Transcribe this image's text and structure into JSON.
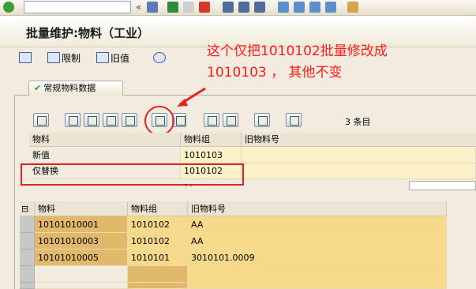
{
  "toolbar": {
    "icons": [
      "enter-icon",
      "save-icon",
      "back-icon",
      "exit-icon",
      "cancel-icon",
      "print-icon",
      "find-icon",
      "find-next-icon",
      "first-page-icon",
      "prev-page-icon",
      "next-page-icon",
      "last-page-icon",
      "new-session-icon"
    ],
    "nav_glyph": "«"
  },
  "title": "批量维护:物料（工业）",
  "app_toolbar": {
    "restrict_label": "限制",
    "old_value_label": "旧值"
  },
  "annotation": {
    "line1": "这个仅把1010102批量修改成",
    "line2": "1010103 ， 其他不变"
  },
  "tab": {
    "label": "常规物料数据",
    "check": "✔"
  },
  "record_count": "3 条目",
  "upper_table": {
    "headers": [
      "物料",
      "物料组",
      "旧物料号"
    ],
    "rows": [
      {
        "label": "新值",
        "group": "1010103",
        "old": ""
      },
      {
        "label": "仅替换",
        "group": "1010102",
        "old": ""
      }
    ],
    "scroll_glyph": "‹ ›"
  },
  "lower_table": {
    "headers": [
      "物料",
      "物料组",
      "旧物料号"
    ],
    "rows": [
      {
        "material": "10101010001",
        "group": "1010102",
        "old": "AA"
      },
      {
        "material": "10101010003",
        "group": "1010102",
        "old": "AA"
      },
      {
        "material": "10101010005",
        "group": "1010101",
        "old": "3010101.0009"
      }
    ]
  },
  "colors": {
    "annotation": "#ff1a1a",
    "cell_highlight": "#f7d98a",
    "cell_key": "#e2b86a",
    "cell_input": "#fdf1c8"
  }
}
